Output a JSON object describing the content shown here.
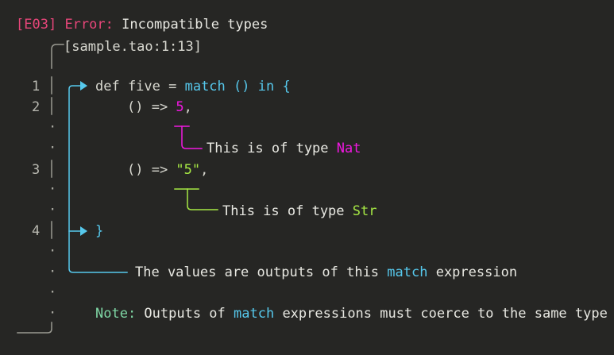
{
  "header": {
    "code": "[E03]",
    "label": "Error:",
    "message": "Incompatible types",
    "location": "[sample.tao:1:13]"
  },
  "lines": [
    {
      "num": "1",
      "parts": [
        "def five = ",
        "match",
        " ",
        "()",
        " ",
        "in",
        " ",
        "{"
      ]
    },
    {
      "num": "2",
      "parts": [
        "() => ",
        "5",
        ","
      ]
    },
    {
      "num": "3",
      "parts": [
        "() => ",
        "\"5\"",
        ","
      ]
    },
    {
      "num": "4",
      "parts": [
        "}"
      ]
    }
  ],
  "labels": {
    "nat": {
      "prefix": "This is of type ",
      "type": "Nat"
    },
    "str": {
      "prefix": "This is of type ",
      "type": "Str"
    },
    "match": {
      "prefix": "The values are outputs of this ",
      "keyword": "match",
      "suffix": " expression"
    }
  },
  "note": {
    "label": "Note:",
    "pre": " Outputs of ",
    "keyword": "match",
    "post": " expressions must coerce to the same type"
  },
  "colors": {
    "error": "#e8467a",
    "keyword": "#56c8ec",
    "nat": "#f018e0",
    "str": "#a6e844",
    "note": "#7ed6a4",
    "background": "#262624"
  }
}
